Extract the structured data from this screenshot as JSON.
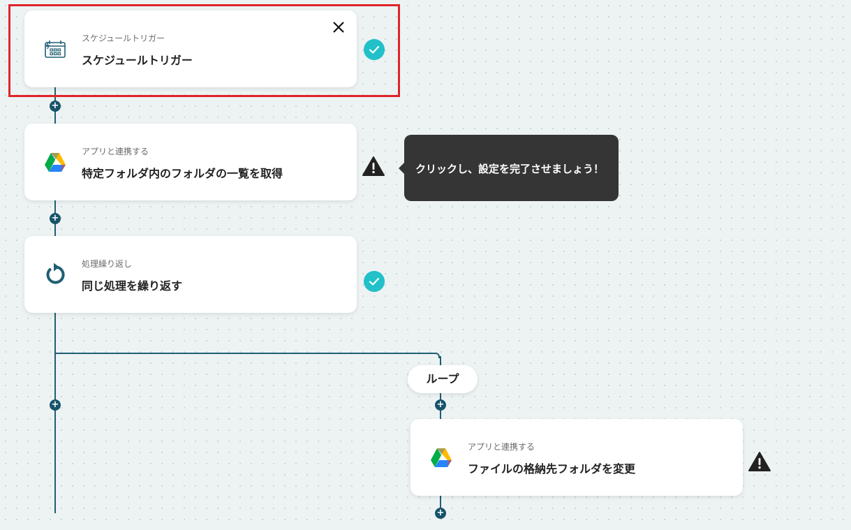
{
  "steps": [
    {
      "subtitle": "スケジュールトリガー",
      "title": "スケジュールトリガー",
      "icon": "calendar-clock-icon",
      "status": "complete"
    },
    {
      "subtitle": "アプリと連携する",
      "title": "特定フォルダ内のフォルダの一覧を取得",
      "icon": "google-drive-icon",
      "status": "warning"
    },
    {
      "subtitle": "処理繰り返し",
      "title": "同じ処理を繰り返す",
      "icon": "repeat-icon",
      "status": "complete"
    },
    {
      "subtitle": "アプリと連携する",
      "title": "ファイルの格納先フォルダを変更",
      "icon": "google-drive-icon",
      "status": "warning"
    }
  ],
  "loop": {
    "label": "ループ"
  },
  "tooltip": {
    "text": "クリックし、設定を完了させましょう！"
  },
  "colors": {
    "accent": "#22c0c9",
    "line": "#1f5f73",
    "highlight": "#e0242a",
    "tooltip_bg": "#353535"
  }
}
